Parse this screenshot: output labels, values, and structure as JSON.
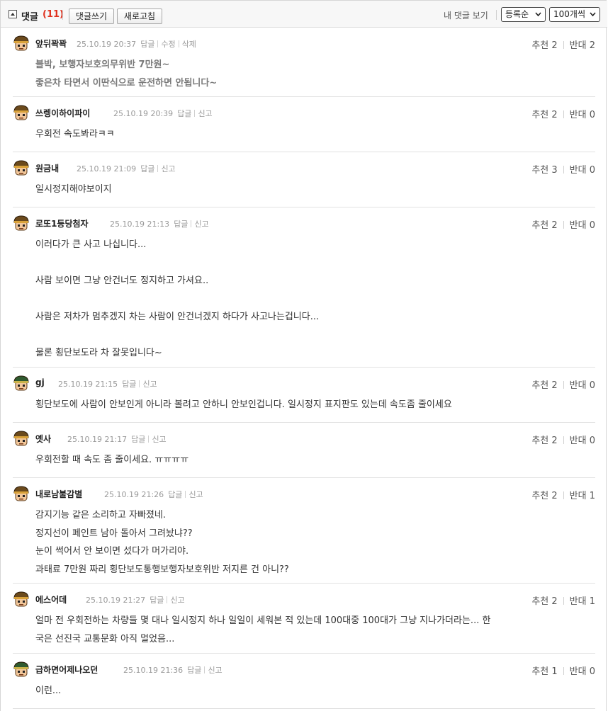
{
  "header": {
    "title": "댓글",
    "count": "(11)",
    "write_button": "댓글쓰기",
    "refresh_button": "새로고침",
    "my_comments_link": "내 댓글 보기",
    "sort_select": "등록순",
    "per_page_select": "100개씩"
  },
  "comments": [
    {
      "nick": "앞뒤꽉꽉",
      "date": "25.10.19 20:37",
      "actions": [
        "답글",
        "수정",
        "삭제"
      ],
      "up_label": "추천",
      "up": "2",
      "down_label": "반대",
      "down": "2",
      "text": "블박, 보행자보호의무위반 7만원~\n좋은차 타면서 이딴식으로 운전하면 안됩니다~"
    },
    {
      "nick": "쓰렝이하이파이",
      "date": "25.10.19 20:39",
      "actions": [
        "답글",
        "신고"
      ],
      "up_label": "추천",
      "up": "2",
      "down_label": "반대",
      "down": "0",
      "text": "우회전 속도봐라ㅋㅋ"
    },
    {
      "nick": "원금내",
      "date": "25.10.19 21:09",
      "actions": [
        "답글",
        "신고"
      ],
      "up_label": "추천",
      "up": "3",
      "down_label": "반대",
      "down": "0",
      "text": "일시정지해야보이지"
    },
    {
      "nick": "로또1등당첨자",
      "date": "25.10.19 21:13",
      "actions": [
        "답글",
        "신고"
      ],
      "up_label": "추천",
      "up": "2",
      "down_label": "반대",
      "down": "0",
      "text": "이러다가 큰 사고 나십니다...\n\n사람 보이면 그냥 안건너도 정지하고 가셔요..\n\n사람은 저차가 멈추겠지 차는 사람이 안건너겠지 하다가 사고나는겁니다...\n\n물론 횡단보도라 차 잘못입니다~"
    },
    {
      "nick": "gj",
      "date": "25.10.19 21:15",
      "actions": [
        "답글",
        "신고"
      ],
      "up_label": "추천",
      "up": "2",
      "down_label": "반대",
      "down": "0",
      "text": "횡단보도에 사람이 안보인게 아니라 볼려고 안하니 안보인겁니다. 일시정지 표지판도 있는데 속도좀 줄이세요"
    },
    {
      "nick": "옛사",
      "date": "25.10.19 21:17",
      "actions": [
        "답글",
        "신고"
      ],
      "up_label": "추천",
      "up": "2",
      "down_label": "반대",
      "down": "0",
      "text": "우회전할 때 속도 좀 줄이세요. ㅠㅠㅠㅠ"
    },
    {
      "nick": "내로남불감별",
      "date": "25.10.19 21:26",
      "actions": [
        "답글",
        "신고"
      ],
      "up_label": "추천",
      "up": "2",
      "down_label": "반대",
      "down": "1",
      "text": "감지기능 같은 소리하고 자빠졌네.\n정지선이 페인트 남아 돌아서 그려놨냐??\n눈이 썩어서 안 보이면 섰다가 머가리야.\n과태료 7만원 짜리 횡단보도통행보행자보호위반 저지른 건 아니??"
    },
    {
      "nick": "에스어데",
      "date": "25.10.19 21:27",
      "actions": [
        "답글",
        "신고"
      ],
      "up_label": "추천",
      "up": "2",
      "down_label": "반대",
      "down": "1",
      "text": "얼마 전 우회전하는 차량들 몇 대나 일시정지 하나 일일이 세워본 적 있는데 100대중 100대가 그냥 지나가더라는... 한\n국은 선진국 교통문화 아직 멀었음..."
    },
    {
      "nick": "급하면어제나오던",
      "date": "25.10.19 21:36",
      "actions": [
        "답글",
        "신고"
      ],
      "up_label": "추천",
      "up": "1",
      "down_label": "반대",
      "down": "0",
      "text": "이런..."
    }
  ],
  "colors": {
    "count_red": "#e0321f",
    "avatar_helmet": "#6b4a1c",
    "avatar_green": "#2f5a2f",
    "text": "#333333",
    "meta": "#999999"
  }
}
